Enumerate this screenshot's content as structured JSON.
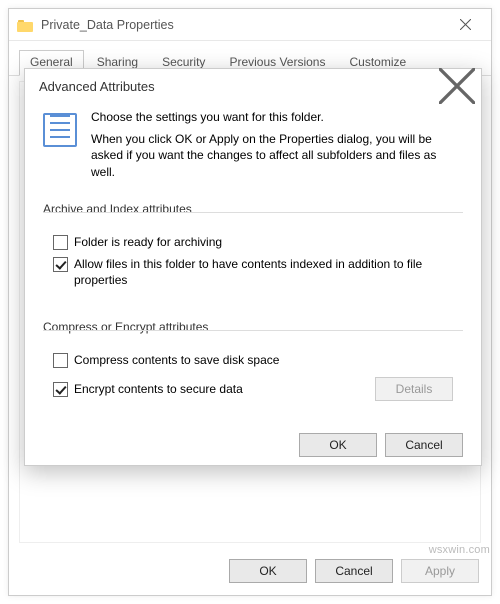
{
  "parent": {
    "title": "Private_Data Properties",
    "tabs": [
      "General",
      "Sharing",
      "Security",
      "Previous Versions",
      "Customize"
    ],
    "active_tab_index": 0,
    "buttons": {
      "ok": "OK",
      "cancel": "Cancel",
      "apply": "Apply"
    }
  },
  "child": {
    "title": "Advanced Attributes",
    "intro_line1": "Choose the settings you want for this folder.",
    "intro_line2": "When you click OK or Apply on the Properties dialog, you will be asked if you want the changes to affect all subfolders and files as well.",
    "group_archive": {
      "label": "Archive and Index attributes",
      "chk_archive": {
        "label": "Folder is ready for archiving",
        "checked": false
      },
      "chk_index": {
        "label": "Allow files in this folder to have contents indexed in addition to file properties",
        "checked": true
      }
    },
    "group_compress": {
      "label": "Compress or Encrypt attributes",
      "chk_compress": {
        "label": "Compress contents to save disk space",
        "checked": false
      },
      "chk_encrypt": {
        "label": "Encrypt contents to secure data",
        "checked": true
      },
      "details_label": "Details"
    },
    "buttons": {
      "ok": "OK",
      "cancel": "Cancel"
    }
  },
  "watermark": "wsxwin.com"
}
